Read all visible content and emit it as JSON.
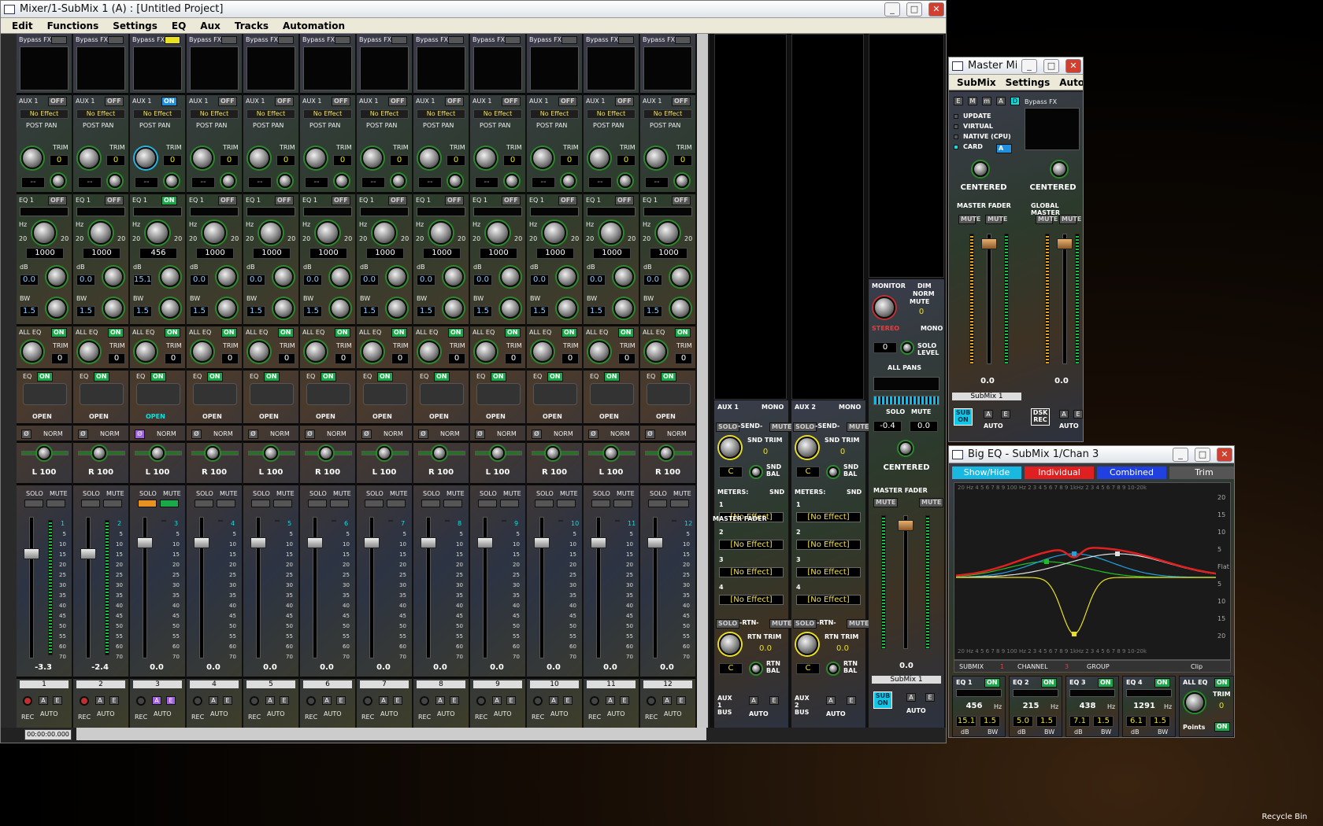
{
  "desktop": {
    "recycle_bin": "Recycle Bin"
  },
  "main_window": {
    "title": "Mixer/1-SubMix 1 (A) : [Untitled Project]",
    "menu": [
      "Edit",
      "Functions",
      "Settings",
      "EQ",
      "Aux",
      "Tracks",
      "Automation"
    ],
    "time": "00:00:00.000"
  },
  "labels": {
    "bypass_fx": "Bypass FX",
    "aux1": "AUX 1",
    "off": "OFF",
    "on": "ON",
    "no_effect": "No Effect",
    "post_pan": "POST PAN",
    "trim": "TRIM",
    "eq1": "EQ 1",
    "hz": "Hz",
    "db": "dB",
    "bw": "BW",
    "all_eq": "ALL EQ",
    "eq": "EQ",
    "open": "OPEN",
    "norm": "NORM",
    "solo": "SOLO",
    "mute": "MUTE",
    "rec": "REC",
    "auto": "AUTO",
    "a": "A",
    "e": "E",
    "twenty": "20",
    "dash": "--",
    "phase": "Ø"
  },
  "channels": [
    {
      "num": "1",
      "aux_state": "OFF",
      "eq1_state": "OFF",
      "freq": "1000",
      "gain": "0.0",
      "bw": "1.5",
      "alleq_trim": "0",
      "eq_state": "ON",
      "pan": "L 100",
      "level": "-3.3",
      "trim": "0"
    },
    {
      "num": "2",
      "aux_state": "OFF",
      "eq1_state": "OFF",
      "freq": "1000",
      "gain": "0.0",
      "bw": "1.5",
      "alleq_trim": "0",
      "eq_state": "ON",
      "pan": "R 100",
      "level": "-2.4",
      "trim": "0"
    },
    {
      "num": "3",
      "aux_state": "ON",
      "eq1_state": "ON",
      "freq": "456",
      "gain": "15.1",
      "bw": "1.5",
      "alleq_trim": "0",
      "eq_state": "ON",
      "pan": "L 100",
      "level": "0.0",
      "trim": "0"
    },
    {
      "num": "4",
      "aux_state": "OFF",
      "eq1_state": "OFF",
      "freq": "1000",
      "gain": "0.0",
      "bw": "1.5",
      "alleq_trim": "0",
      "eq_state": "ON",
      "pan": "R 100",
      "level": "0.0",
      "trim": "0"
    },
    {
      "num": "5",
      "aux_state": "OFF",
      "eq1_state": "OFF",
      "freq": "1000",
      "gain": "0.0",
      "bw": "1.5",
      "alleq_trim": "0",
      "eq_state": "ON",
      "pan": "L 100",
      "level": "0.0",
      "trim": "0"
    },
    {
      "num": "6",
      "aux_state": "OFF",
      "eq1_state": "OFF",
      "freq": "1000",
      "gain": "0.0",
      "bw": "1.5",
      "alleq_trim": "0",
      "eq_state": "ON",
      "pan": "R 100",
      "level": "0.0",
      "trim": "0"
    },
    {
      "num": "7",
      "aux_state": "OFF",
      "eq1_state": "OFF",
      "freq": "1000",
      "gain": "0.0",
      "bw": "1.5",
      "alleq_trim": "0",
      "eq_state": "ON",
      "pan": "L 100",
      "level": "0.0",
      "trim": "0"
    },
    {
      "num": "8",
      "aux_state": "OFF",
      "eq1_state": "OFF",
      "freq": "1000",
      "gain": "0.0",
      "bw": "1.5",
      "alleq_trim": "0",
      "eq_state": "ON",
      "pan": "R 100",
      "level": "0.0",
      "trim": "0"
    },
    {
      "num": "9",
      "aux_state": "OFF",
      "eq1_state": "OFF",
      "freq": "1000",
      "gain": "0.0",
      "bw": "1.5",
      "alleq_trim": "0",
      "eq_state": "ON",
      "pan": "L 100",
      "level": "0.0",
      "trim": "0"
    },
    {
      "num": "10",
      "aux_state": "OFF",
      "eq1_state": "OFF",
      "freq": "1000",
      "gain": "0.0",
      "bw": "1.5",
      "alleq_trim": "0",
      "eq_state": "ON",
      "pan": "R 100",
      "level": "0.0",
      "trim": "0"
    },
    {
      "num": "11",
      "aux_state": "OFF",
      "eq1_state": "OFF",
      "freq": "1000",
      "gain": "0.0",
      "bw": "1.5",
      "alleq_trim": "0",
      "eq_state": "ON",
      "pan": "L 100",
      "level": "0.0",
      "trim": "0"
    },
    {
      "num": "12",
      "aux_state": "OFF",
      "eq1_state": "OFF",
      "freq": "1000",
      "gain": "0.0",
      "bw": "1.5",
      "alleq_trim": "0",
      "eq_state": "ON",
      "pan": "R 100",
      "level": "0.0",
      "trim": "0"
    }
  ],
  "scale": [
    "0",
    "5",
    "10",
    "15",
    "20",
    "25",
    "30",
    "35",
    "40",
    "45",
    "50",
    "55",
    "60",
    "70"
  ],
  "aux_buses": [
    {
      "name": "AUX 1",
      "mono": "MONO",
      "send": "-SEND-",
      "snd_trim": "SND TRIM",
      "snd_val": "0",
      "bal": "C",
      "snd_bal": "SND BAL",
      "meters": "METERS:",
      "snd": "SND",
      "slots": [
        "[No Effect]",
        "[No Effect]",
        "[No Effect]",
        "[No Effect]"
      ],
      "rtn": "-RTN-",
      "rtn_trim": "RTN TRIM",
      "rtn_val": "0.0",
      "rtn_bal": "RTN BAL",
      "bus_label": "AUX 1 BUS",
      "bus_num": "1"
    },
    {
      "name": "AUX 2",
      "mono": "MONO",
      "send": "-SEND-",
      "snd_trim": "SND TRIM",
      "snd_val": "0",
      "bal": "C",
      "snd_bal": "SND BAL",
      "meters": "METERS:",
      "snd": "SND",
      "slots": [
        "[No Effect]",
        "[No Effect]",
        "[No Effect]",
        "[No Effect]"
      ],
      "rtn": "-RTN-",
      "rtn_trim": "RTN TRIM",
      "rtn_val": "0.0",
      "rtn_bal": "RTN BAL",
      "bus_label": "AUX 2 BUS",
      "bus_num": "2"
    }
  ],
  "monitor": {
    "title": "MONITOR",
    "dim": "DIM",
    "norm": "NORM",
    "mute": "MUTE",
    "stereo": "STEREO",
    "mono": "MONO",
    "value": "0",
    "solo_level": "SOLO LEVEL",
    "solo_val": "0",
    "all_pans": "ALL PANS",
    "solo": "SOLO",
    "mute2": "MUTE",
    "left": "-0.4",
    "right": "0.0",
    "centered": "CENTERED",
    "master_fader": "MASTER FADER",
    "fader_val": "0.0",
    "submix": "SubMix 1",
    "sub_on": "SUB ON",
    "master_fader_tab": "MASTER FADER"
  },
  "master_window": {
    "title": "Master Mixer: [U...",
    "menu": [
      "SubMix",
      "Settings",
      "Automation"
    ],
    "modes": [
      "E",
      "M",
      "m",
      "A",
      "D"
    ],
    "options": [
      "UPDATE",
      "VIRTUAL",
      "NATIVE (CPU)",
      "CARD"
    ],
    "card_val": "A",
    "bypass_fx": "Bypass FX",
    "centered_left": "CENTERED",
    "centered_right": "CENTERED",
    "master_fader": "MASTER FADER",
    "global_master": "GLOBAL MASTER",
    "mute": "MUTE",
    "left_val": "0.0",
    "right_val": "0.0",
    "submix": "SubMix 1",
    "sub_on": "SUB ON",
    "dsk_rec": "DSK REC",
    "auto": "AUTO",
    "a": "A",
    "e": "E"
  },
  "big_eq": {
    "title": "Big EQ - SubMix 1/Chan 3",
    "tabs": [
      "Show/Hide",
      "Individual",
      "Combined",
      "Trim"
    ],
    "top_axis": "20 Hz   4  5  6 7 8 9 100 Hz   2     3    4  5  6 7 8 9 1kHz   2     3    4  5 6 7 8 9 10-20k",
    "y_right": [
      "20",
      "15",
      "10",
      "5",
      "Flat",
      "5",
      "10",
      "15",
      "20"
    ],
    "submix": "SUBMIX",
    "submix_n": "1",
    "channel": "CHANNEL",
    "channel_n": "3",
    "group": "GROUP",
    "clip": "Clip",
    "bands": [
      {
        "name": "EQ 1",
        "on": "ON",
        "freq": "456",
        "gain": "15.1",
        "bw": "1.5"
      },
      {
        "name": "EQ 2",
        "on": "ON",
        "freq": "215",
        "gain": "5.0",
        "bw": "1.5"
      },
      {
        "name": "EQ 3",
        "on": "ON",
        "freq": "438",
        "gain": "7.1",
        "bw": "1.5"
      },
      {
        "name": "EQ 4",
        "on": "ON",
        "freq": "1291",
        "gain": "6.1",
        "bw": "1.5"
      }
    ],
    "all_eq": "ALL EQ",
    "trim": "TRIM",
    "trim_val": "0",
    "points": "Points",
    "points_on": "ON",
    "hz": "Hz",
    "db": "dB",
    "bw": "BW",
    "colors": {
      "red": "#e02020",
      "yellow": "#e8e020",
      "green": "#20c020",
      "cyan": "#20a0e0",
      "white": "#e0e0e0"
    }
  }
}
